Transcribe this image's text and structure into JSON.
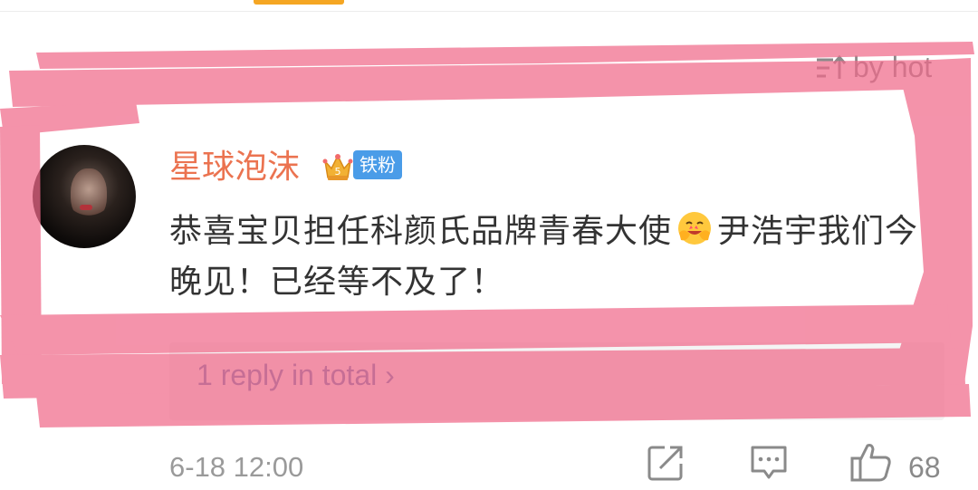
{
  "sort": {
    "label": "by hot",
    "icon": "sort-icon"
  },
  "comment": {
    "username": "星球泡沫",
    "fan_badge": "铁粉",
    "crown_level": "5",
    "text_part1": "恭喜宝贝担任科颜氏品牌青春大使",
    "text_part2": "尹浩宇我们今晚见！已经等不及了！",
    "reply_link": "1 reply in total ›",
    "time": "6-18 12:00",
    "like_count": "68"
  },
  "colors": {
    "username": "#eb7350",
    "badge": "#4a9ce8",
    "highlight": "#f06a8a",
    "tab_indicator": "#f5a623"
  }
}
